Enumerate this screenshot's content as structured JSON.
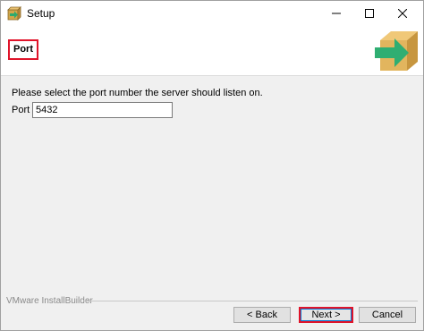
{
  "window": {
    "title": "Setup",
    "controls": {
      "minimize": "minimize",
      "maximize": "maximize",
      "close": "close"
    }
  },
  "header": {
    "title": "Port",
    "logo_icon": "installer-box-arrow-icon",
    "highlight_color": "#e0142a"
  },
  "body": {
    "instruction": "Please select the port number the server should listen on.",
    "port_label": "Port",
    "port_value": "5432"
  },
  "footer": {
    "brand": "VMware InstallBuilder",
    "back_label": "< Back",
    "next_label": "Next >",
    "cancel_label": "Cancel"
  }
}
